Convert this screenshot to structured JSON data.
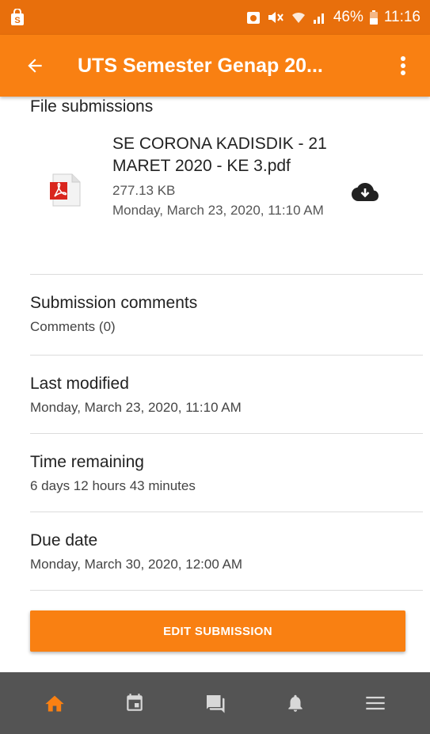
{
  "status_bar": {
    "battery": "46%",
    "time": "11:16"
  },
  "header": {
    "title": "UTS Semester Genap 20..."
  },
  "file_submissions": {
    "heading": "File submissions",
    "file": {
      "name": "SE CORONA KADISDIK - 21 MARET 2020 - KE 3.pdf",
      "size": "277.13 KB",
      "date": "Monday, March 23, 2020, 11:10 AM"
    }
  },
  "submission_comments": {
    "label": "Submission comments",
    "value": "Comments (0)"
  },
  "last_modified": {
    "label": "Last modified",
    "value": "Monday, March 23, 2020, 11:10 AM"
  },
  "time_remaining": {
    "label": "Time remaining",
    "value": "6 days 12 hours 43 minutes"
  },
  "due_date": {
    "label": "Due date",
    "value": "Monday, March 30, 2020, 12:00 AM"
  },
  "actions": {
    "edit_label": "EDIT SUBMISSION"
  },
  "bottom_nav": {
    "items": [
      "home-icon",
      "calendar-icon",
      "messages-icon",
      "notifications-icon",
      "menu-icon"
    ]
  },
  "colors": {
    "accent": "#f98012",
    "status_bar": "#e86f0c",
    "nav_background": "#545454"
  }
}
